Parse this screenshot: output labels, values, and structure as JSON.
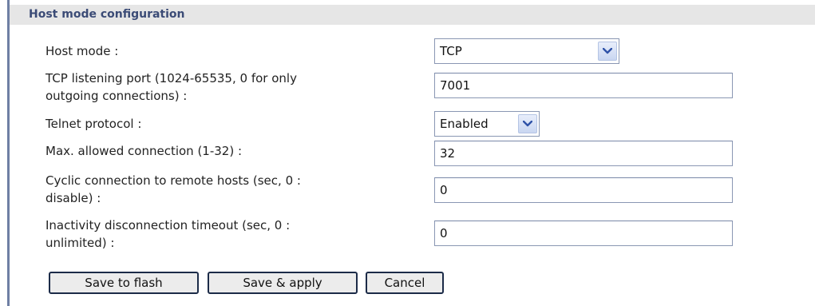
{
  "header": {
    "title": "Host mode configuration"
  },
  "fields": {
    "host_mode": {
      "label": "Host mode :",
      "value": "TCP"
    },
    "tcp_port": {
      "label": "TCP listening port (1024-65535, 0 for only\noutgoing connections) :",
      "value": "7001"
    },
    "telnet": {
      "label": "Telnet protocol :",
      "value": "Enabled"
    },
    "max_conn": {
      "label": "Max. allowed connection (1-32) :",
      "value": "32"
    },
    "cyclic": {
      "label": "Cyclic connection to remote hosts (sec, 0 :\ndisable) :",
      "value": "0"
    },
    "inactivity": {
      "label": "Inactivity disconnection timeout (sec, 0 :\nunlimited) :",
      "value": "0"
    }
  },
  "buttons": {
    "save_flash": "Save to flash",
    "save_apply": "Save & apply",
    "cancel": "Cancel"
  },
  "icons": {
    "dropdown": "chevron-down-icon"
  },
  "colors": {
    "header_bg": "#e6e6e6",
    "header_text": "#3b4b76",
    "left_rule": "#6f7fa4",
    "input_border": "#8a97b3",
    "button_border": "#1c2b48",
    "arrow_glyph": "#2f52a8"
  }
}
